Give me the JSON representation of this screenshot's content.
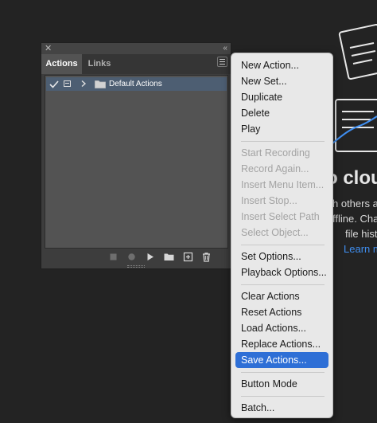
{
  "background": {
    "heading_fragment": "o clou",
    "text_lines": [
      "h others a",
      "ffline. Cha",
      "file histo"
    ],
    "link": "Learn m"
  },
  "panel": {
    "tabs": [
      {
        "label": "Actions",
        "active": true
      },
      {
        "label": "Links",
        "active": false
      }
    ],
    "close_glyph": "✕",
    "collapse_glyph": "‹‹",
    "rows": [
      {
        "label": "Default Actions",
        "checked": true,
        "expanded": false,
        "icon": "folder-icon"
      }
    ],
    "toolbar_icons": [
      "stop-icon",
      "record-icon",
      "play-icon",
      "new-set-folder-icon",
      "new-action-icon",
      "trash-icon"
    ]
  },
  "menu": {
    "groups": [
      [
        {
          "label": "New Action...",
          "enabled": true
        },
        {
          "label": "New Set...",
          "enabled": true
        },
        {
          "label": "Duplicate",
          "enabled": true
        },
        {
          "label": "Delete",
          "enabled": true
        },
        {
          "label": "Play",
          "enabled": true
        }
      ],
      [
        {
          "label": "Start Recording",
          "enabled": false
        },
        {
          "label": "Record Again...",
          "enabled": false
        },
        {
          "label": "Insert Menu Item...",
          "enabled": false
        },
        {
          "label": "Insert Stop...",
          "enabled": false
        },
        {
          "label": "Insert Select Path",
          "enabled": false
        },
        {
          "label": "Select Object...",
          "enabled": false
        }
      ],
      [
        {
          "label": "Set Options...",
          "enabled": true
        },
        {
          "label": "Playback Options...",
          "enabled": true
        }
      ],
      [
        {
          "label": "Clear Actions",
          "enabled": true
        },
        {
          "label": "Reset Actions",
          "enabled": true
        },
        {
          "label": "Load Actions...",
          "enabled": true
        },
        {
          "label": "Replace Actions...",
          "enabled": true
        },
        {
          "label": "Save Actions...",
          "enabled": true,
          "selected": true
        }
      ],
      [
        {
          "label": "Button Mode",
          "enabled": true
        }
      ],
      [
        {
          "label": "Batch...",
          "enabled": true
        }
      ]
    ]
  },
  "colors": {
    "selection": "#2e6fd6",
    "row_highlight": "#4d5e72",
    "link": "#3f8ef0"
  }
}
